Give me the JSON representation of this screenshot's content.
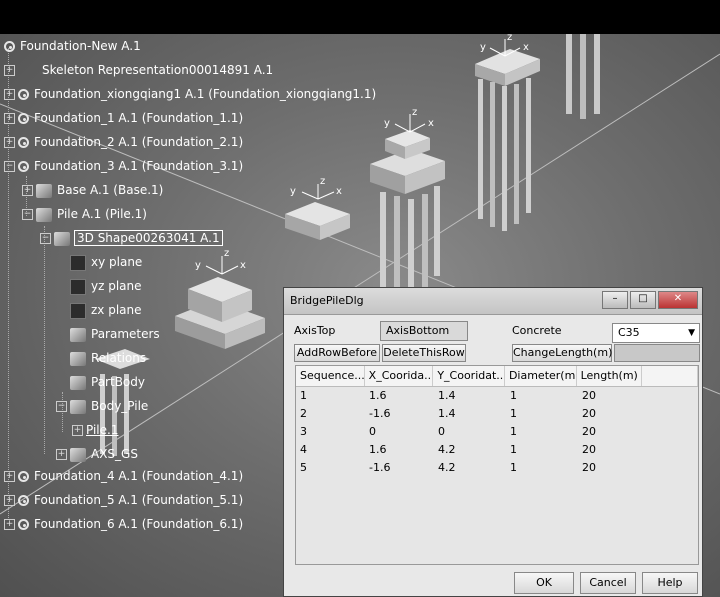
{
  "tree": {
    "root": "Foundation-New A.1",
    "skeleton": "Skeleton Representation00014891 A.1",
    "foundation_xq": "Foundation_xiongqiang1 A.1 (Foundation_xiongqiang1.1)",
    "foundation_1": "Foundation_1 A.1 (Foundation_1.1)",
    "foundation_2": "Foundation_2 A.1 (Foundation_2.1)",
    "foundation_3": "Foundation_3 A.1 (Foundation_3.1)",
    "base": "Base A.1 (Base.1)",
    "pile": "Pile A.1 (Pile.1)",
    "shape": "3D Shape00263041 A.1",
    "xy_plane": "xy plane",
    "yz_plane": "yz plane",
    "zx_plane": "zx plane",
    "parameters": "Parameters",
    "relations": "Relations",
    "partbody": "PartBody",
    "body_pile": "Body_Pile",
    "pile1": "Pile.1",
    "axs_gs": "AXS_GS",
    "foundation_4": "Foundation_4 A.1 (Foundation_4.1)",
    "foundation_5": "Foundation_5 A.1 (Foundation_5.1)",
    "foundation_6": "Foundation_6 A.1 (Foundation_6.1)"
  },
  "axes": {
    "x": "x",
    "y": "y",
    "z": "z"
  },
  "dialog": {
    "title": "BridgePileDlg",
    "axis_top": "AxisTop",
    "axis_bottom": "AxisBottom",
    "concrete_label": "Concrete",
    "concrete_value": "C35",
    "add_row": "AddRowBefore",
    "delete_row": "DeleteThisRow",
    "change_length": "ChangeLength(m)",
    "columns": [
      "Sequence...",
      "X_Coorida...",
      "Y_Cooridat...",
      "Diameter(m)",
      "Length(m)"
    ],
    "rows": [
      [
        "1",
        "1.6",
        "1.4",
        "1",
        "20"
      ],
      [
        "2",
        "-1.6",
        "1.4",
        "1",
        "20"
      ],
      [
        "3",
        "0",
        "0",
        "1",
        "20"
      ],
      [
        "4",
        "1.6",
        "4.2",
        "1",
        "20"
      ],
      [
        "5",
        "-1.6",
        "4.2",
        "1",
        "20"
      ]
    ],
    "ok": "OK",
    "cancel": "Cancel",
    "help": "Help"
  }
}
